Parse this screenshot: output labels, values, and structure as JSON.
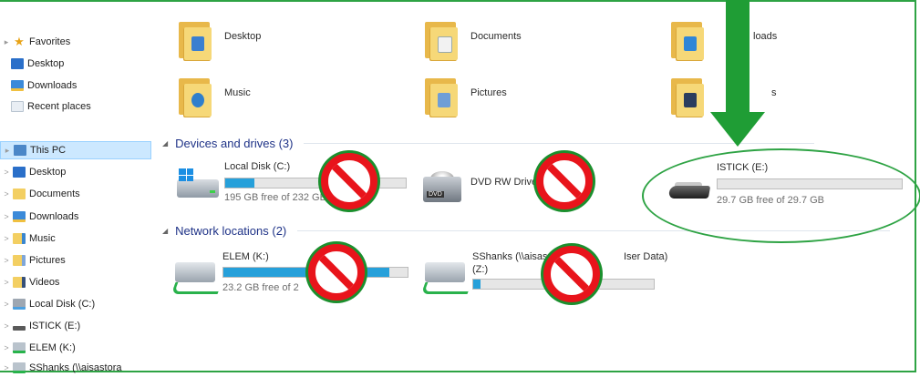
{
  "nav": {
    "favorites": "Favorites",
    "fav_items": [
      "Desktop",
      "Downloads",
      "Recent places"
    ],
    "this_pc": "This PC",
    "pc_items": [
      "Desktop",
      "Documents",
      "Downloads",
      "Music",
      "Pictures",
      "Videos",
      "Local Disk (C:)",
      "ISTICK (E:)",
      "ELEM (K:)",
      "SShanks (\\\\aisastora"
    ]
  },
  "folders": [
    {
      "label": "Desktop"
    },
    {
      "label": "Documents"
    },
    {
      "label": "loads"
    },
    {
      "label": "Music"
    },
    {
      "label": "Pictures"
    },
    {
      "label": "s"
    }
  ],
  "groups": {
    "devices": "Devices and drives (3)",
    "network": "Network locations (2)"
  },
  "drives": [
    {
      "name": "Local Disk (C:)",
      "free_text": "195 GB free of 232 GB",
      "used_fraction": 0.16
    },
    {
      "name": "DVD RW Drive (D:)",
      "free_text": "",
      "used_fraction": null
    },
    {
      "name": "ISTICK (E:)",
      "free_text": "29.7 GB free of 29.7 GB",
      "used_fraction": 0.0
    }
  ],
  "network": [
    {
      "name": "ELEM (K:)",
      "free_text": "23.2 GB free of 2",
      "used_fraction": 0.9
    },
    {
      "name": "SShanks (\\\\aisas",
      "name2": "Iser Data)",
      "name_line2": "(Z:)",
      "free_text": "",
      "used_fraction": 0.04
    }
  ],
  "colors": {
    "annotation_green": "#1f9d35",
    "ban_red": "#e8141b",
    "bar_blue": "#26a0da",
    "header_blue": "#1e3287"
  }
}
